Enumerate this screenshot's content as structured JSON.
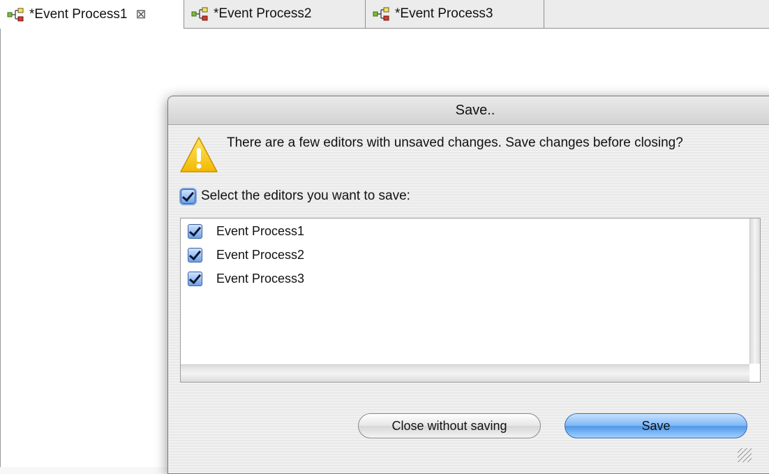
{
  "tabs": [
    {
      "label": "*Event Process1",
      "active": true,
      "closable": true
    },
    {
      "label": "*Event Process2",
      "active": false
    },
    {
      "label": "*Event Process3",
      "active": false
    }
  ],
  "tab_icon": "process-diagram-icon",
  "close_glyph": "⊠",
  "dialog": {
    "title": "Save..",
    "message": "There are a few editors with unsaved changes. Save changes before closing?",
    "select_all_label": "Select the editors you want to save:",
    "select_all_checked": true,
    "editors": [
      {
        "label": "Event Process1",
        "checked": true
      },
      {
        "label": "Event Process2",
        "checked": true
      },
      {
        "label": "Event Process3",
        "checked": true
      }
    ],
    "close_without_saving_label": "Close without saving",
    "save_label": "Save"
  },
  "colors": {
    "accent": "#4f97e8",
    "warning": "#f5c400"
  }
}
